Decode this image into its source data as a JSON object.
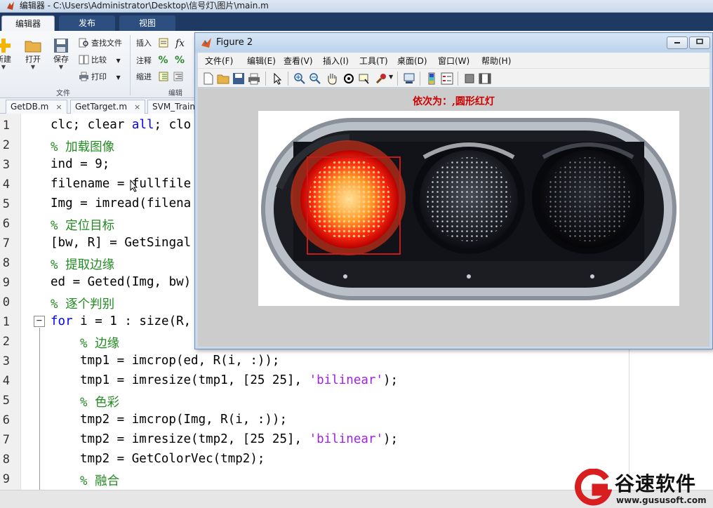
{
  "window": {
    "title": "编辑器 - C:\\Users\\Administrator\\Desktop\\信号灯\\图片\\main.m"
  },
  "ribbon": {
    "tabs": [
      "编辑器",
      "发布",
      "视图"
    ],
    "new_label": "新建",
    "open_label": "打开",
    "save_label": "保存",
    "find_files_label": "查找文件",
    "compare_label": "比较",
    "print_label": "打印",
    "insert_label": "插入",
    "fx_label": "fx",
    "comment_label": "注释",
    "indent_label": "缩进",
    "file_group_label": "文件",
    "edit_group_label": "编辑"
  },
  "file_tabs": [
    "GetDB.m",
    "GetTarget.m",
    "SVM_Train"
  ],
  "code": {
    "line_numbers": [
      "1",
      "2",
      "3",
      "4",
      "5",
      "6",
      "7",
      "8",
      "9",
      "0",
      "1",
      "2",
      "3",
      "4",
      "5",
      "6",
      "7",
      "8",
      "9"
    ],
    "l1_a": "clc; clear ",
    "l1_kw": "all",
    "l1_b": "; clo",
    "l2": "% 加载图像",
    "l3": "ind = 9;",
    "l4": "filename = fullfile",
    "l5": "Img = imread(filena",
    "l6": "% 定位目标",
    "l7": "[bw, R] = GetSingal",
    "l8": "% 提取边缘",
    "l9": "ed = Geted(Img, bw)",
    "l10": "% 逐个判别",
    "l11_kw": "for",
    "l11": " i = 1 : size(R,",
    "l12": "% 边缘",
    "l13": "tmp1 = imcrop(ed, R(i, :));",
    "l14_a": "tmp1 = imresize(tmp1, [25 25], ",
    "l14_str": "'bilinear'",
    "l14_b": ");",
    "l15": "% 色彩",
    "l16": "tmp2 = imcrop(Img, R(i, :));",
    "l17_a": "tmp2 = imresize(tmp2, [25 25], ",
    "l17_str": "'bilinear'",
    "l17_b": ");",
    "l18": "tmp2 = GetColorVec(tmp2);",
    "l19": "% 融合"
  },
  "figure": {
    "title": "Figure 2",
    "menus": [
      "文件(F)",
      "编辑(E)",
      "查看(V)",
      "插入(I)",
      "工具(T)",
      "桌面(D)",
      "窗口(W)",
      "帮助(H)"
    ],
    "plot_title": "依次为：,圆形红灯"
  },
  "watermark": {
    "name": "谷速软件",
    "url": "www.gususoft.com"
  },
  "colors": {
    "keyword": "#0000ff",
    "comment": "#228b22",
    "string": "#a020f0",
    "plot_title": "#cc0000",
    "ribbon_bar": "#1e3a63"
  }
}
